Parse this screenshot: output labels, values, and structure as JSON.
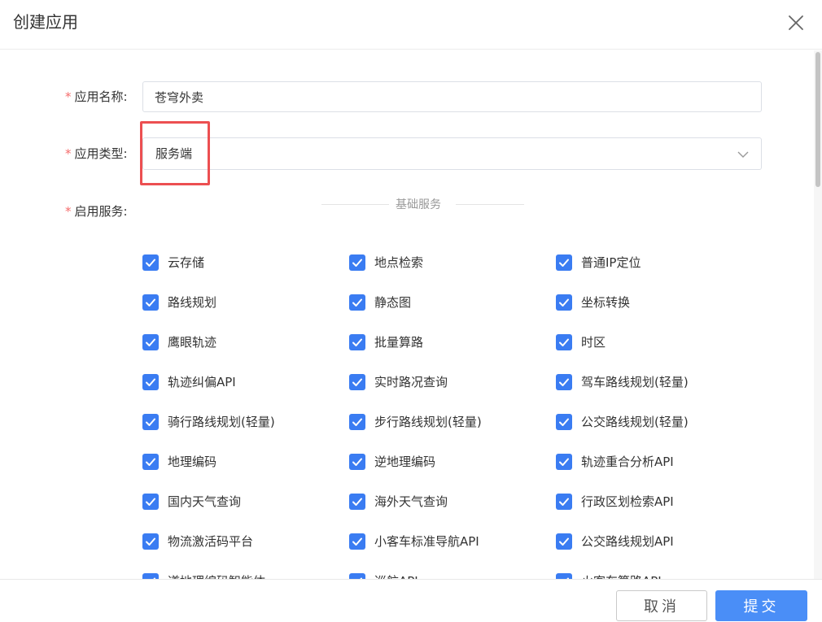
{
  "dialog": {
    "title": "创建应用"
  },
  "form": {
    "app_name": {
      "label": "应用名称:",
      "value": "苍穹外卖"
    },
    "app_type": {
      "label": "应用类型:",
      "value": "服务端"
    },
    "services": {
      "label": "启用服务:",
      "section_title": "基础服务",
      "items": [
        {
          "label": "云存储",
          "checked": true
        },
        {
          "label": "地点检索",
          "checked": true
        },
        {
          "label": "普通IP定位",
          "checked": true
        },
        {
          "label": "路线规划",
          "checked": true
        },
        {
          "label": "静态图",
          "checked": true
        },
        {
          "label": "坐标转换",
          "checked": true
        },
        {
          "label": "鹰眼轨迹",
          "checked": true
        },
        {
          "label": "批量算路",
          "checked": true
        },
        {
          "label": "时区",
          "checked": true
        },
        {
          "label": "轨迹纠偏API",
          "checked": true
        },
        {
          "label": "实时路况查询",
          "checked": true
        },
        {
          "label": "驾车路线规划(轻量)",
          "checked": true
        },
        {
          "label": "骑行路线规划(轻量)",
          "checked": true
        },
        {
          "label": "步行路线规划(轻量)",
          "checked": true
        },
        {
          "label": "公交路线规划(轻量)",
          "checked": true
        },
        {
          "label": "地理编码",
          "checked": true
        },
        {
          "label": "逆地理编码",
          "checked": true
        },
        {
          "label": "轨迹重合分析API",
          "checked": true
        },
        {
          "label": "国内天气查询",
          "checked": true
        },
        {
          "label": "海外天气查询",
          "checked": true
        },
        {
          "label": "行政区划检索API",
          "checked": true
        },
        {
          "label": "物流激活码平台",
          "checked": true
        },
        {
          "label": "小客车标准导航API",
          "checked": true
        },
        {
          "label": "公交路线规划API",
          "checked": true
        },
        {
          "label": "道地理编码智能体",
          "checked": true
        },
        {
          "label": "巡航API",
          "checked": true
        },
        {
          "label": "火客车算路API",
          "checked": true
        }
      ]
    }
  },
  "footer": {
    "cancel_label": "取消",
    "submit_label": "提交"
  },
  "colors": {
    "accent": "#3a7cf2",
    "submit": "#4a8ef7",
    "required": "#f56c6c",
    "highlight": "#ec4f51"
  },
  "icons": {
    "close": "close-icon",
    "dropdown": "chevron-down-icon",
    "check": "check-icon"
  }
}
